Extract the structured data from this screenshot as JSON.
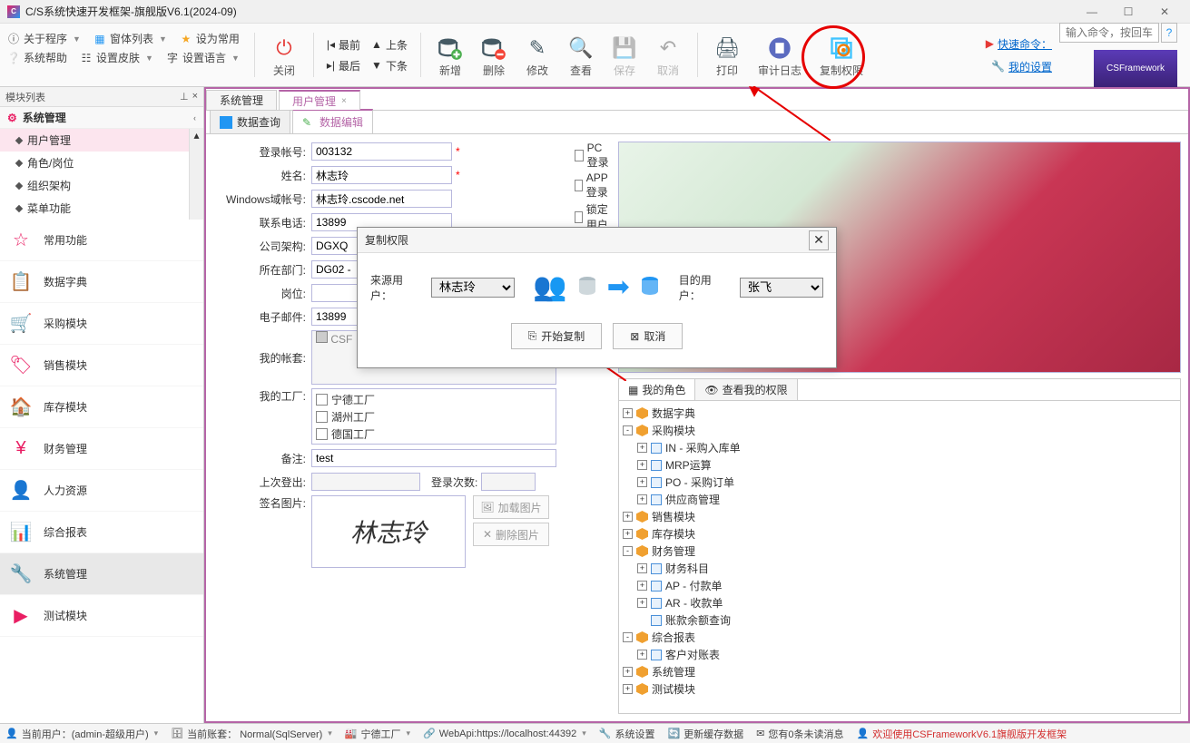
{
  "titlebar": {
    "title": "C/S系统快速开发框架-旗舰版V6.1(2024-09)"
  },
  "toolbar_left": {
    "about": "关于程序",
    "windows": "窗体列表",
    "set_common": "设为常用",
    "help": "系统帮助",
    "skin": "设置皮肤",
    "lang": "设置语言"
  },
  "toolbar_nav": {
    "first": "最前",
    "prev": "上条",
    "last": "最后",
    "next": "下条"
  },
  "toolbar_big": {
    "close": "关闭",
    "add": "新增",
    "delete": "删除",
    "edit": "修改",
    "view": "查看",
    "save": "保存",
    "cancel": "取消",
    "print": "打印",
    "audit": "审计日志",
    "copy_perm": "复制权限"
  },
  "toolbar_right": {
    "cmd_label": "快速命令：",
    "cmd_placeholder": "输入命令，按回车",
    "settings": "我的设置",
    "banner": "CSFramework"
  },
  "sidebar": {
    "header": "模块列表",
    "group": "系统管理",
    "tree": [
      "用户管理",
      "角色/岗位",
      "组织架构",
      "菜单功能"
    ],
    "modules": [
      "常用功能",
      "数据字典",
      "采购模块",
      "销售模块",
      "库存模块",
      "财务管理",
      "人力资源",
      "综合报表",
      "系统管理",
      "测试模块"
    ]
  },
  "tabs": {
    "sys": "系统管理",
    "user": "用户管理"
  },
  "inner_tabs": {
    "query": "数据查询",
    "edit": "数据编辑"
  },
  "form": {
    "account_label": "登录帐号:",
    "account": "003132",
    "name_label": "姓名:",
    "name": "林志玲",
    "domain_label": "Windows域帐号:",
    "domain": "林志玲.cscode.net",
    "phone_label": "联系电话:",
    "phone": "13899",
    "company_label": "公司架构:",
    "company": "DGXQ",
    "dept_label": "所在部门:",
    "dept": "DG02 -",
    "position_label": "岗位:",
    "email_label": "电子邮件:",
    "email": "13899",
    "books_label": "我的帐套:",
    "books": "CSF",
    "factory_label": "我的工厂:",
    "factories": [
      "宁德工厂",
      "湖州工厂",
      "德国工厂"
    ],
    "remark_label": "备注:",
    "remark": "test",
    "last_login_label": "上次登出:",
    "login_count_label": "登录次数:",
    "sign_label": "签名图片:",
    "sign_text": "林志玲",
    "load_img": "加载图片",
    "del_img": "删除图片",
    "chk_pc": "PC登录",
    "chk_app": "APP登录",
    "chk_lock": "锁定用户"
  },
  "role_tabs": {
    "my_role": "我的角色",
    "view_perm": "查看我的权限"
  },
  "perm_tree": [
    {
      "t": "数据字典",
      "l": 0,
      "e": "+",
      "i": "cube"
    },
    {
      "t": "采购模块",
      "l": 0,
      "e": "-",
      "i": "cube"
    },
    {
      "t": "IN - 采购入库单",
      "l": 1,
      "e": "+",
      "i": "doc"
    },
    {
      "t": "MRP运算",
      "l": 1,
      "e": "+",
      "i": "doc"
    },
    {
      "t": "PO - 采购订单",
      "l": 1,
      "e": "+",
      "i": "doc"
    },
    {
      "t": "供应商管理",
      "l": 1,
      "e": "+",
      "i": "doc"
    },
    {
      "t": "销售模块",
      "l": 0,
      "e": "+",
      "i": "cube"
    },
    {
      "t": "库存模块",
      "l": 0,
      "e": "+",
      "i": "cube"
    },
    {
      "t": "财务管理",
      "l": 0,
      "e": "-",
      "i": "cube"
    },
    {
      "t": "财务科目",
      "l": 1,
      "e": "+",
      "i": "doc"
    },
    {
      "t": "AP - 付款单",
      "l": 1,
      "e": "+",
      "i": "doc"
    },
    {
      "t": "AR - 收款单",
      "l": 1,
      "e": "+",
      "i": "doc"
    },
    {
      "t": "账款余额查询",
      "l": 1,
      "e": "",
      "i": "doc"
    },
    {
      "t": "综合报表",
      "l": 0,
      "e": "-",
      "i": "cube"
    },
    {
      "t": "客户对账表",
      "l": 1,
      "e": "+",
      "i": "doc"
    },
    {
      "t": "系统管理",
      "l": 0,
      "e": "+",
      "i": "cube"
    },
    {
      "t": "测试模块",
      "l": 0,
      "e": "+",
      "i": "cube"
    }
  ],
  "modal": {
    "title": "复制权限",
    "src_label": "来源用户：",
    "src": "林志玲",
    "dst_label": "目的用户：",
    "dst": "张飞",
    "start": "开始复制",
    "cancel": "取消"
  },
  "status": {
    "user": "当前用户：(admin-超级用户)",
    "book": "当前账套： Normal(SqlServer)",
    "factory": "宁德工厂",
    "api": "WebApi:https://localhost:44392",
    "settings": "系统设置",
    "cache": "更新缓存数据",
    "msg": "您有0条未读消息",
    "welcome": "欢迎使用CSFrameworkV6.1旗舰版开发框架"
  }
}
